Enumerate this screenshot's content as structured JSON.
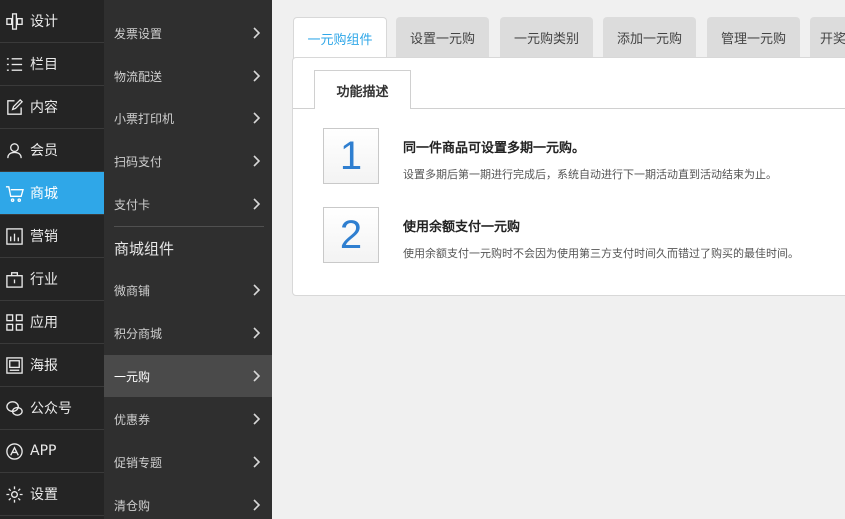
{
  "rail": {
    "items": [
      {
        "label": "设计",
        "icon": "design-icon"
      },
      {
        "label": "栏目",
        "icon": "list-icon"
      },
      {
        "label": "内容",
        "icon": "edit-icon"
      },
      {
        "label": "会员",
        "icon": "user-icon"
      },
      {
        "label": "商城",
        "icon": "cart-icon",
        "active": true
      },
      {
        "label": "营销",
        "icon": "chart-icon"
      },
      {
        "label": "行业",
        "icon": "industry-icon"
      },
      {
        "label": "应用",
        "icon": "apps-icon"
      },
      {
        "label": "海报",
        "icon": "poster-icon"
      },
      {
        "label": "公众号",
        "icon": "wechat-icon"
      },
      {
        "label": "APP",
        "icon": "app-store-icon"
      },
      {
        "label": "设置",
        "icon": "gear-icon"
      }
    ],
    "active_color": "#2fa7e8"
  },
  "sub": {
    "items_top": [
      "发票设置",
      "物流配送",
      "小票打印机",
      "扫码支付",
      "支付卡"
    ],
    "section_title": "商城组件",
    "items_bottom": [
      "微商铺",
      "积分商城",
      "一元购",
      "优惠券",
      "促销专题",
      "清仓购"
    ],
    "active": "一元购"
  },
  "tabs": [
    "一元购组件",
    "设置一元购",
    "一元购类别",
    "添加一元购",
    "管理一元购",
    "开奖"
  ],
  "panel": {
    "inner_tab": "功能描述",
    "features": [
      {
        "num": "1",
        "title": "同一件商品可设置多期一元购。",
        "desc": "设置多期后第一期进行完成后，系统自动进行下一期活动直到活动结束为止。"
      },
      {
        "num": "2",
        "title": "使用余额支付一元购",
        "desc": "使用余额支付一元购时不会因为使用第三方支付时间久而错过了购买的最佳时间。"
      }
    ]
  }
}
